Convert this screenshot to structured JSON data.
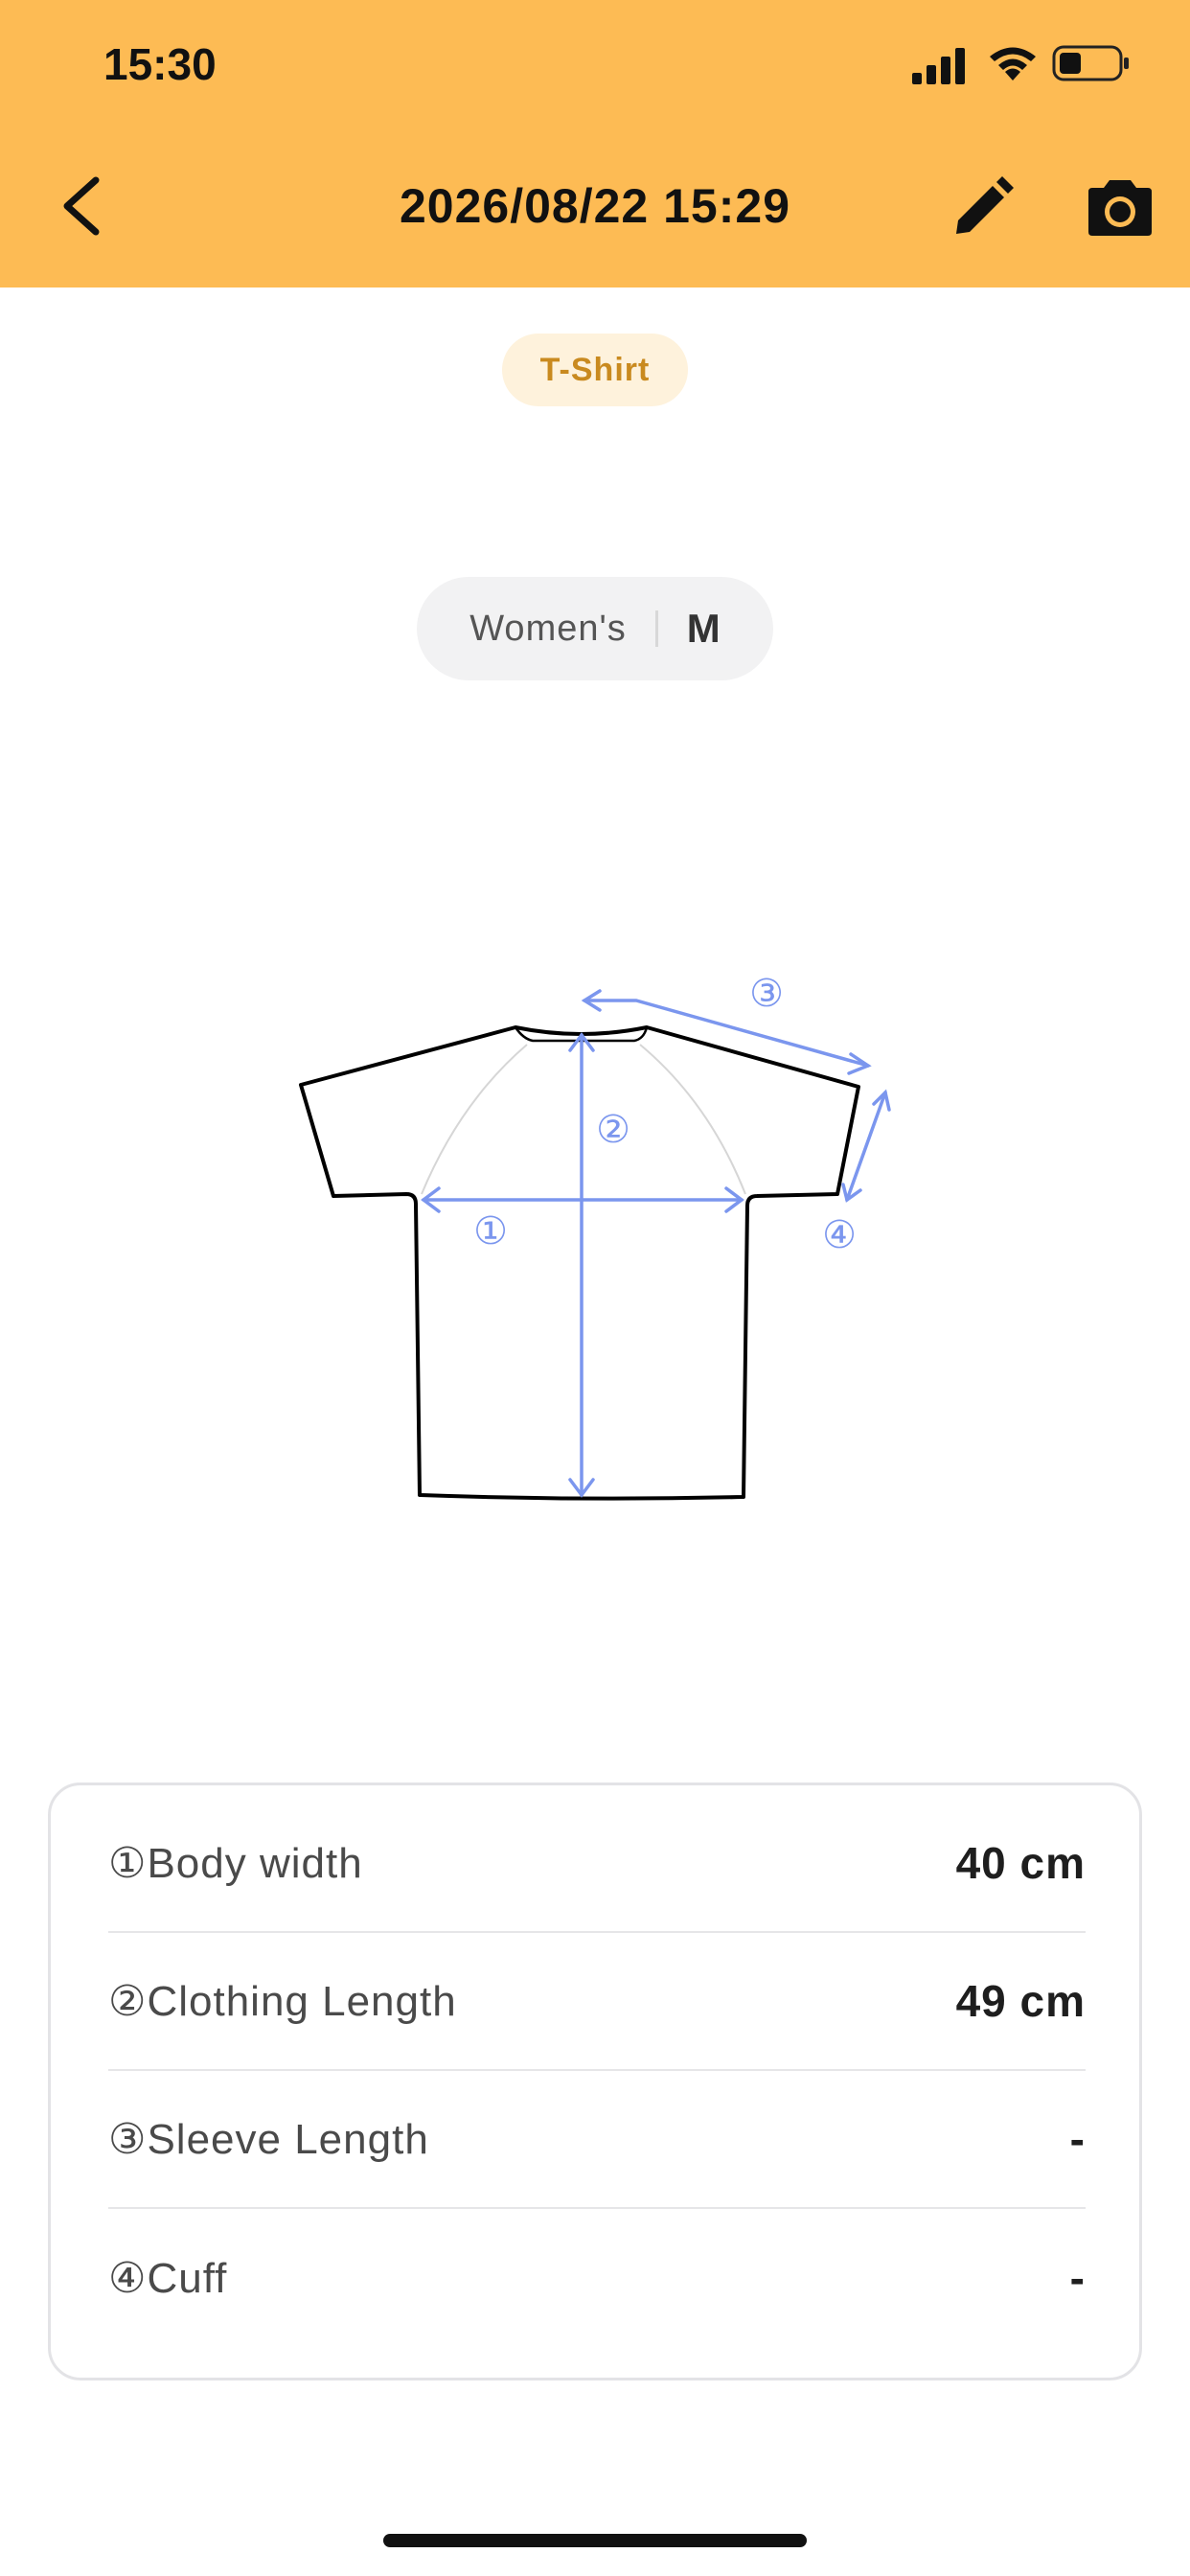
{
  "status_bar": {
    "time": "15:30"
  },
  "nav": {
    "title": "2026/08/22 15:29"
  },
  "category": {
    "label": "T-Shirt"
  },
  "size": {
    "gender": "Women's",
    "value": "M"
  },
  "diagram": {
    "markers": [
      "①",
      "②",
      "③",
      "④"
    ],
    "line_color": "#7B96EE",
    "outline_color": "#000000"
  },
  "measurements": [
    {
      "label": "①Body width",
      "value": "40 cm"
    },
    {
      "label": "②Clothing Length",
      "value": "49 cm"
    },
    {
      "label": "③Sleeve Length",
      "value": "-"
    },
    {
      "label": "④Cuff",
      "value": "-"
    }
  ],
  "colors": {
    "header": "#FDBB54",
    "chip_bg": "#FEF2DC",
    "chip_text": "#C98A1F"
  }
}
